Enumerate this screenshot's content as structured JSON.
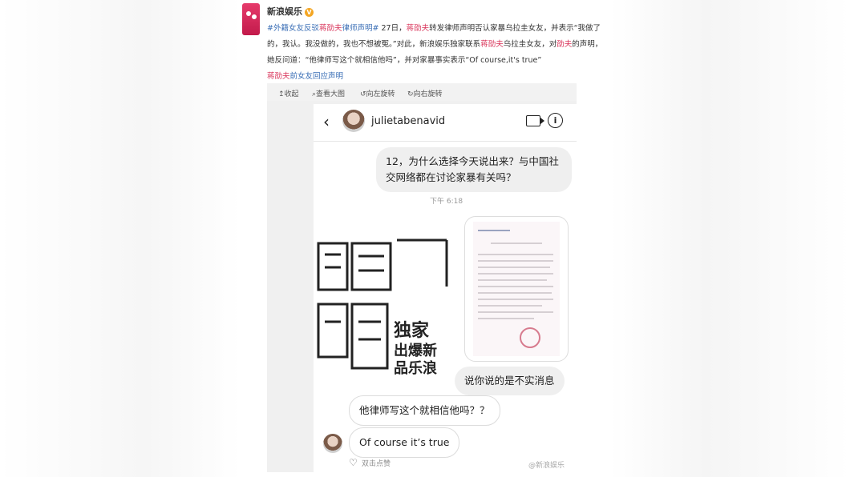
{
  "post": {
    "author": "新浪娱乐",
    "verified_mark": "V",
    "tags": [
      "#外籍女友反驳",
      "蒋劭夫",
      "律师声明#"
    ],
    "text_parts": [
      "27日，",
      "蒋劭夫",
      "转发律师声明否认家暴乌拉圭女友，并表示“我做了的，我认。我没做的，我也不想被冤。”对此，新浪娱乐独家联系",
      "蒋劭夫",
      "乌拉圭女友，对",
      "劭夫",
      "的声明，她反问道：“他律师写这个就相信他吗”，并对家暴事实表示“Of course,it's true”"
    ],
    "link": "前女友回应声明",
    "link_name": "蒋劭夫"
  },
  "toolbar": {
    "collapse": "↥收起",
    "view_large": "⌕查看大图",
    "rotate_left": "↺向左旋转",
    "rotate_right": "↻向右旋转"
  },
  "chat": {
    "username": "julietabenavid",
    "question": "12，为什么选择今天说出来？与中国社交网络都在讨论家暴有关吗？",
    "time": "下午 6:18",
    "logo_chars": "独家 出爆新 品乐浪",
    "reply_untrue": "说你说的是不实消息",
    "reply_lawyer": "他律师写这个就相信他吗？？",
    "reply_course": "Of course it’s true",
    "like_hint": "双击点赞",
    "watermark": "@新浪娱乐"
  },
  "icons": {
    "back": "chevron-left-icon",
    "video": "video-call-icon",
    "info": "info-icon",
    "heart": "heart-icon"
  }
}
